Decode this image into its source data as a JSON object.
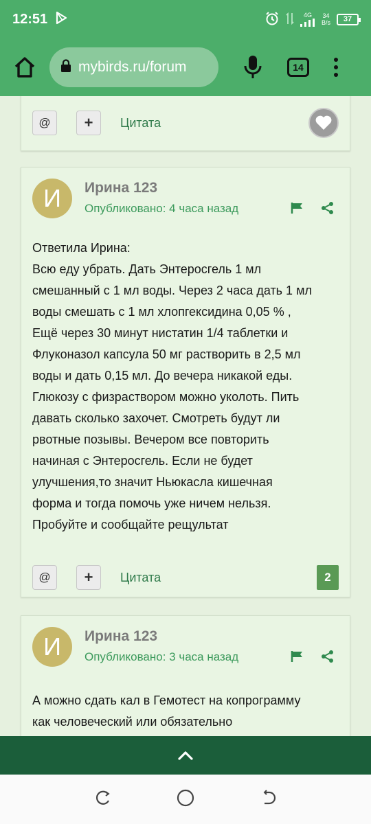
{
  "status": {
    "time": "12:51",
    "net_type": "4G",
    "speed_value": "34",
    "speed_unit": "B/s",
    "battery": "37"
  },
  "browser": {
    "url": "mybirds.ru/forum",
    "tab_count": "14"
  },
  "card_prev": {
    "quote_label": "Цитата"
  },
  "post1": {
    "avatar_letter": "И",
    "author": "Ирина 123",
    "published": "Опубликовано: 4 часа назад",
    "body": [
      "Ответила Ирина:",
      "Всю еду убрать. Дать Энтеросгель 1 мл",
      "смешанный с 1 мл воды. Через 2 часа дать 1 мл",
      "воды смешать с 1 мл хлопгексидина 0,05 % ,",
      "Ещё через 30 минут нистатин 1/4 таблетки и",
      "Флуконазол капсула 50 мг растворить в 2,5 мл",
      "воды и дать 0,15 мл. До вечера никакой еды.",
      "Глюкозу с физраствором можно уколоть. Пить",
      "давать сколько захочет. Смотреть будут ли",
      "рвотные позывы. Вечером все повторить",
      "начиная с Энтеросгель. Если не будет",
      "улучшения,то значит Ньюкасла кишечная",
      "форма и тогда помочь уже ничем нельзя.",
      "Пробуйте и сообщайте рещультат"
    ],
    "quote_label": "Цитата",
    "reputation": "2"
  },
  "post2": {
    "avatar_letter": "И",
    "author": "Ирина 123",
    "published": "Опубликовано: 3 часа назад",
    "body": [
      "А можно сдать кал в Гемотест на копрограмму",
      "как человеческий или обязательно"
    ]
  },
  "colors": {
    "header": "#4cae6a",
    "page_bg": "#e6f1df",
    "accent": "#3c9a5c",
    "bottom_bar": "#1b5e3a"
  }
}
